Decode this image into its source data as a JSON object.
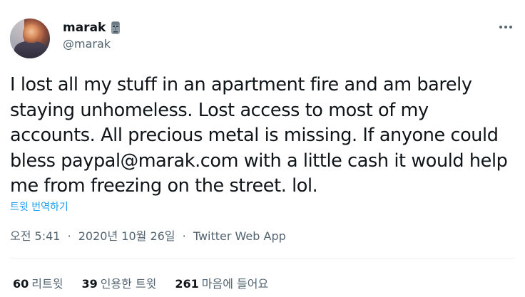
{
  "author": {
    "display_name": "marak",
    "handle": "@marak",
    "badge_icon": "moai-icon"
  },
  "tweet": {
    "text": "I lost all my stuff in an apartment fire and am barely staying unhomeless. Lost access to most of my accounts. All precious metal is missing. If anyone could bless paypal@marak.com with a little cash it would help me from freezing on the street. lol.",
    "translate_label": "트윗 번역하기",
    "time": "오전 5:41",
    "date": "2020년 10월 26일",
    "separator": "·",
    "source": "Twitter Web App"
  },
  "stats": {
    "retweets": {
      "count": "60",
      "label": "리트윗"
    },
    "quotes": {
      "count": "39",
      "label": "인용한 트윗"
    },
    "likes": {
      "count": "261",
      "label": "마음에 들어요"
    }
  },
  "colors": {
    "link": "#1d9bf0",
    "secondary_text": "#536471",
    "primary_text": "#0f1419"
  }
}
